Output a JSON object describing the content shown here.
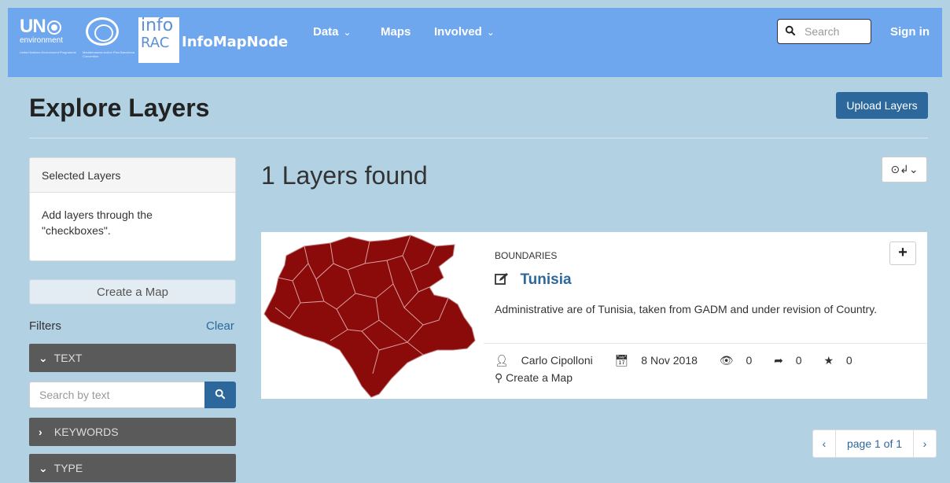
{
  "nav": {
    "un_logo_text": "UN",
    "un_logo_sub": "environment",
    "un_logo_small": "United Nations Environment Programme",
    "map_logo_small": "Mediterranean Action Plan Barcelona Convention",
    "info_logo_line1": "info",
    "info_logo_line2": "RAC",
    "brand": "InfoMapNode",
    "items": [
      {
        "label": "Data",
        "has_dropdown": true
      },
      {
        "label": "Maps",
        "has_dropdown": false
      },
      {
        "label": "Involved",
        "has_dropdown": true
      }
    ],
    "search_placeholder": "Search",
    "sign_in": "Sign in"
  },
  "header": {
    "title": "Explore Layers",
    "upload_button": "Upload Layers"
  },
  "sidebar": {
    "selected_title": "Selected Layers",
    "selected_hint": "Add layers through the \"checkboxes\".",
    "create_map": "Create a Map",
    "filters_label": "Filters",
    "clear_label": "Clear",
    "text_filter": "TEXT",
    "text_search_placeholder": "Search by text",
    "keywords_filter": "KEYWORDS",
    "type_filter": "TYPE"
  },
  "results": {
    "count_text": "1 Layers found",
    "sort_icon": "sort-order-icon",
    "items": [
      {
        "category": "BOUNDARIES",
        "title": "Tunisia",
        "description": "Administrative are of Tunisia, taken from GADM and under revision of Country.",
        "owner": "Carlo Cipolloni",
        "date": "8 Nov 2018",
        "views": "0",
        "shares": "0",
        "stars": "0",
        "create_map": "Create a Map",
        "map_color": "#8b0a0a"
      }
    ]
  },
  "pagination": {
    "prev": "‹",
    "current": "page 1 of 1",
    "next": "›"
  }
}
